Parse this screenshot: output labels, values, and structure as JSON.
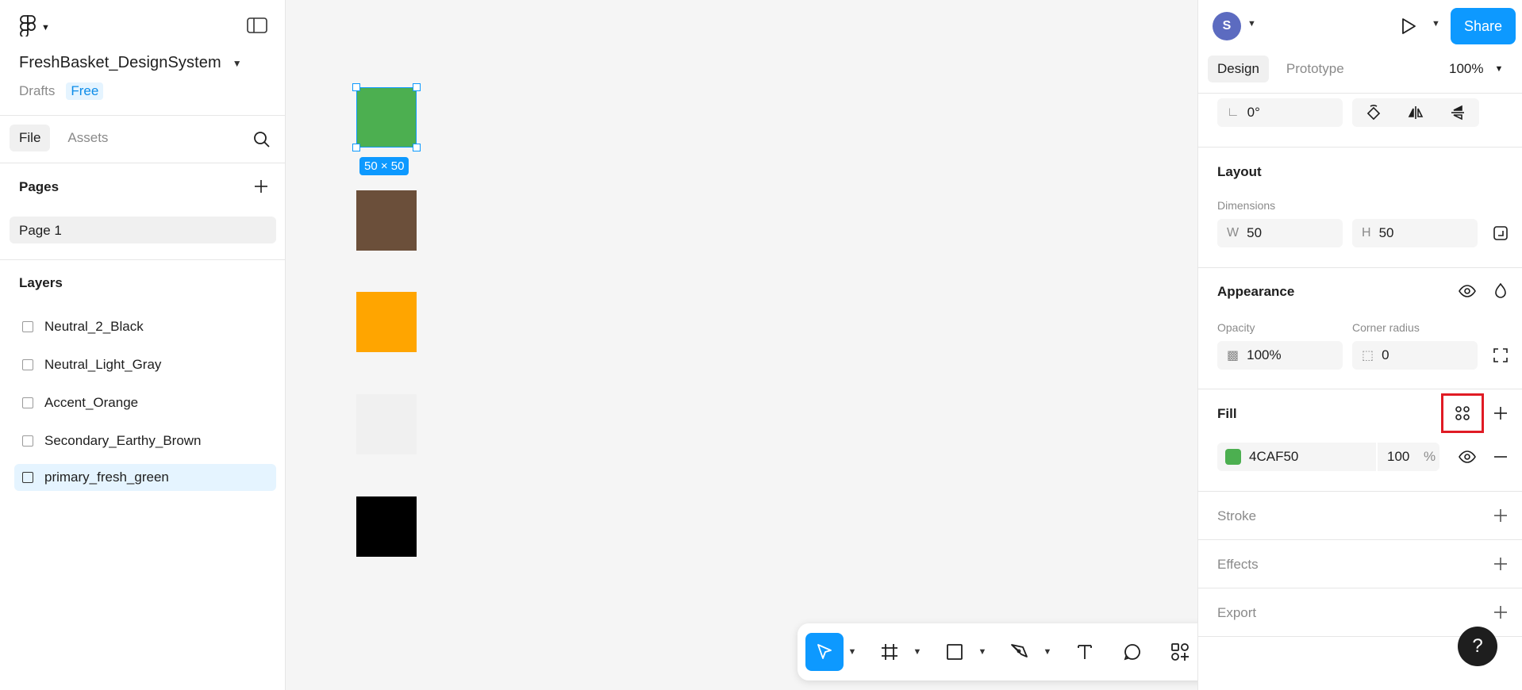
{
  "file": {
    "name": "FreshBasket_DesignSystem",
    "location": "Drafts",
    "plan_badge": "Free"
  },
  "left_tabs": [
    "File",
    "Assets"
  ],
  "pages": {
    "title": "Pages",
    "items": [
      "Page 1"
    ]
  },
  "layers": {
    "title": "Layers",
    "items": [
      "Neutral_2_Black",
      "Neutral_Light_Gray",
      "Accent_Orange",
      "Secondary_Earthy_Brown",
      "primary_fresh_green"
    ],
    "selected": "primary_fresh_green"
  },
  "canvas": {
    "selection_size": "50 × 50",
    "swatches": [
      {
        "layer": "primary_fresh_green",
        "color": "#4CAF50"
      },
      {
        "layer": "Secondary_Earthy_Brown",
        "color": "#6B4F3A"
      },
      {
        "layer": "Accent_Orange",
        "color": "#FFA500"
      },
      {
        "layer": "Neutral_Light_Gray",
        "color": "#F0F0F0"
      },
      {
        "layer": "Neutral_2_Black",
        "color": "#000000"
      }
    ]
  },
  "header": {
    "avatar_initial": "S",
    "share_label": "Share"
  },
  "right_tabs": [
    "Design",
    "Prototype"
  ],
  "zoom": "100%",
  "rotation": "0°",
  "layout": {
    "title": "Layout",
    "dimensions_label": "Dimensions",
    "w_prefix": "W",
    "w_value": "50",
    "h_prefix": "H",
    "h_value": "50"
  },
  "appearance": {
    "title": "Appearance",
    "opacity_label": "Opacity",
    "opacity_value": "100%",
    "corner_label": "Corner radius",
    "corner_value": "0"
  },
  "fill": {
    "title": "Fill",
    "hex": "4CAF50",
    "color": "#4CAF50",
    "opacity": "100",
    "unit": "%"
  },
  "stroke_title": "Stroke",
  "effects_title": "Effects",
  "export_title": "Export",
  "help_label": "?",
  "colors": {
    "accent": "#0d99ff",
    "highlight": "#e01b24"
  }
}
